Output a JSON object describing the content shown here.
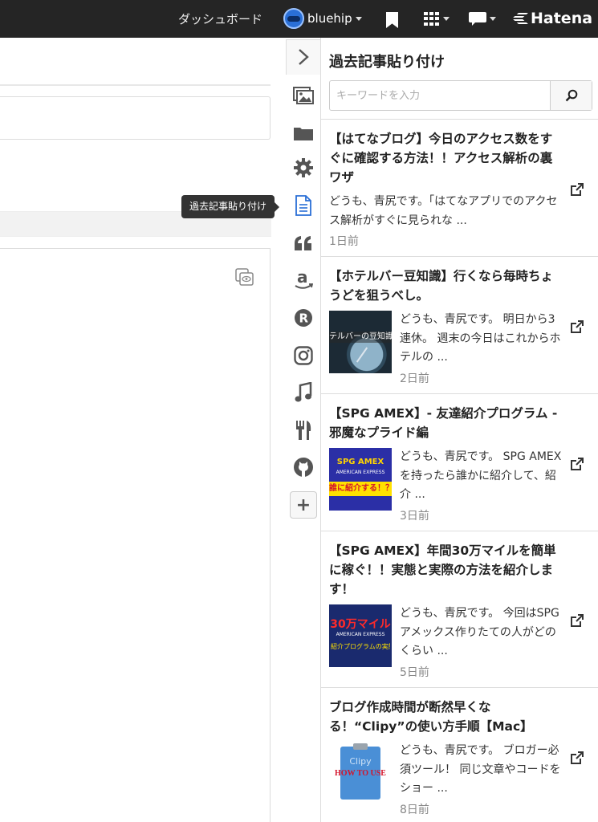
{
  "topbar": {
    "dashboard_label": "ダッシュボード",
    "username": "bluehip",
    "logo_text": "Hatena"
  },
  "tooltip": {
    "text": "過去記事貼り付け"
  },
  "rail": {
    "icons": [
      "chevron-right-icon",
      "image-icon",
      "folder-icon",
      "gear-icon",
      "document-icon",
      "quote-icon",
      "amazon-icon",
      "rakuten-icon",
      "instagram-icon",
      "music-icon",
      "restaurant-icon",
      "github-icon",
      "plus-icon"
    ],
    "plus_label": "+"
  },
  "panel": {
    "title": "過去記事貼り付け",
    "search_placeholder": "キーワードを入力",
    "entries": [
      {
        "title": "【はてなブログ】今日のアクセス数をすぐに確認する方法！！アクセス解析の裏ワザ",
        "excerpt": "どうも、青尻です。「はてなアプリでのアクセス解析がすぐに見られな ...",
        "date": "1日前",
        "has_thumb": false
      },
      {
        "title": "【ホテルバー豆知識】行くなら毎時ちょうどを狙うべし。",
        "excerpt": "どうも、青尻です。 明日から3連休。 週末の今日はこれからホテルの ...",
        "date": "2日前",
        "has_thumb": true,
        "thumb_text": "テルバーの豆知識"
      },
      {
        "title": "【SPG AMEX】- 友達紹介プログラム - 邪魔なプライド編",
        "excerpt": "どうも、青尻です。 SPG AMEXを持ったら誰かに紹介して、紹介 ...",
        "date": "3日前",
        "has_thumb": true,
        "thumb_text": "SPG AMEX",
        "thumb_sub": "AMERICAN EXPRESS",
        "thumb_text2": "誰に紹介する！？"
      },
      {
        "title": "【SPG AMEX】年間30万マイルを簡単に稼ぐ！！実態と実際の方法を紹介します！",
        "excerpt": "どうも、青尻です。 今回はSPGアメックス作りたての人がどのくらい ...",
        "date": "5日前",
        "has_thumb": true,
        "thumb_text": "30万マイル",
        "thumb_sub": "AMERICAN EXPRESS",
        "thumb_text2": "紹介プログラムの実態"
      },
      {
        "title": "ブログ作成時間が断然早くなる！“Clipy”の使い方手順【Mac】",
        "excerpt": "どうも、青尻です。 ブロガー必須ツール！ 同じ文章やコードをショー ...",
        "date": "8日前",
        "has_thumb": true,
        "thumb_text": "HOW TO USE",
        "thumb_sub": "Clipy"
      }
    ]
  },
  "colors": {
    "topbar_bg": "#252525",
    "accent_blue": "#2a6fd6",
    "icon_gray": "#555555"
  }
}
